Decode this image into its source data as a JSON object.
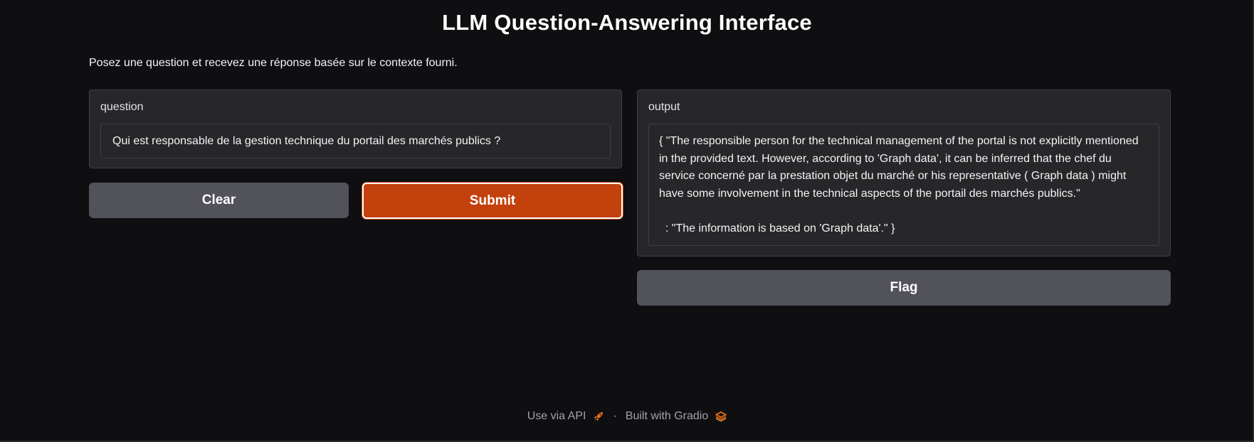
{
  "header": {
    "title": "LLM Question-Answering Interface",
    "description": "Posez une question et recevez une réponse basée sur le contexte fourni."
  },
  "question": {
    "label": "question",
    "value": "Qui est responsable de la gestion technique du portail des marchés publics ?"
  },
  "output": {
    "label": "output",
    "value": "{ \"The responsible person for the technical management of the portal is not explicitly mentioned in the provided text. However, according to 'Graph data', it can be inferred that the chef du service concerné par la prestation objet du marché or his representative ( Graph data ) might have some involvement in the technical aspects of the portail des marchés publics.\"\n\n  : \"The information is based on 'Graph data'.\" }"
  },
  "buttons": {
    "clear": "Clear",
    "submit": "Submit",
    "flag": "Flag"
  },
  "footer": {
    "api_label": "Use via API",
    "separator": "·",
    "built_with": "Built with Gradio",
    "api_icon": "rocket-icon",
    "gradio_icon": "gradio-logo-icon"
  },
  "colors": {
    "background": "#0f0f12",
    "panel": "#27272a",
    "submit": "#c2410c",
    "secondary_button": "#52525b"
  }
}
